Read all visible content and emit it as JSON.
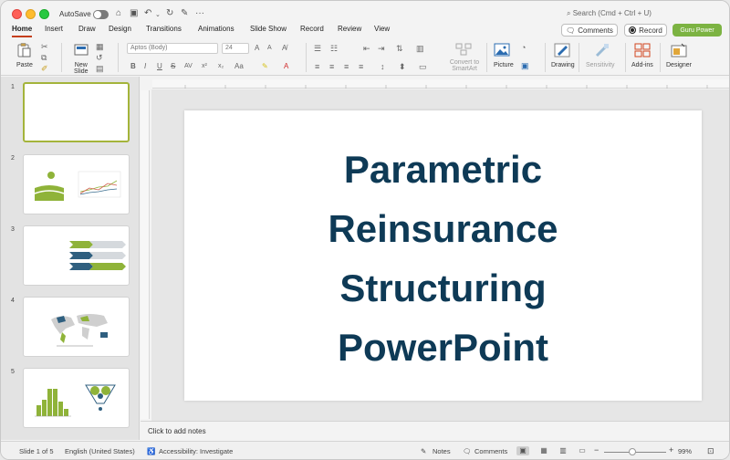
{
  "titlebar": {
    "autosave_label": "AutoSave",
    "search_placeholder": "Search (Cmd + Ctrl + U)"
  },
  "tabs": [
    {
      "label": "Home",
      "active": true
    },
    {
      "label": "Insert"
    },
    {
      "label": "Draw"
    },
    {
      "label": "Design"
    },
    {
      "label": "Transitions"
    },
    {
      "label": "Animations"
    },
    {
      "label": "Slide Show"
    },
    {
      "label": "Record"
    },
    {
      "label": "Review"
    },
    {
      "label": "View"
    }
  ],
  "header_buttons": {
    "comments": "Comments",
    "record": "Record",
    "guru": "Guru Power"
  },
  "ribbon": {
    "paste": "Paste",
    "new_slide": "New\nSlide",
    "font_name": "Aptos (Body)",
    "font_size": "24",
    "convert_smartart": "Convert to SmartArt",
    "picture": "Picture",
    "drawing": "Drawing",
    "sensitivity": "Sensitivity",
    "addins": "Add-ins",
    "designer": "Designer"
  },
  "slides": [
    {
      "number": "1"
    },
    {
      "number": "2"
    },
    {
      "number": "3"
    },
    {
      "number": "4"
    },
    {
      "number": "5"
    }
  ],
  "slide": {
    "title_lines": [
      "Parametric",
      "Reinsurance",
      "Structuring",
      "PowerPoint"
    ]
  },
  "notes_placeholder": "Click to add notes",
  "statusbar": {
    "slide_info": "Slide 1 of 5",
    "language": "English (United States)",
    "accessibility": "Accessibility: Investigate",
    "notes": "Notes",
    "comments": "Comments",
    "zoom": "99%"
  },
  "colors": {
    "accent_green": "#7cb342",
    "title_navy": "#0e3a56",
    "tab_underline": "#c43e1c"
  }
}
